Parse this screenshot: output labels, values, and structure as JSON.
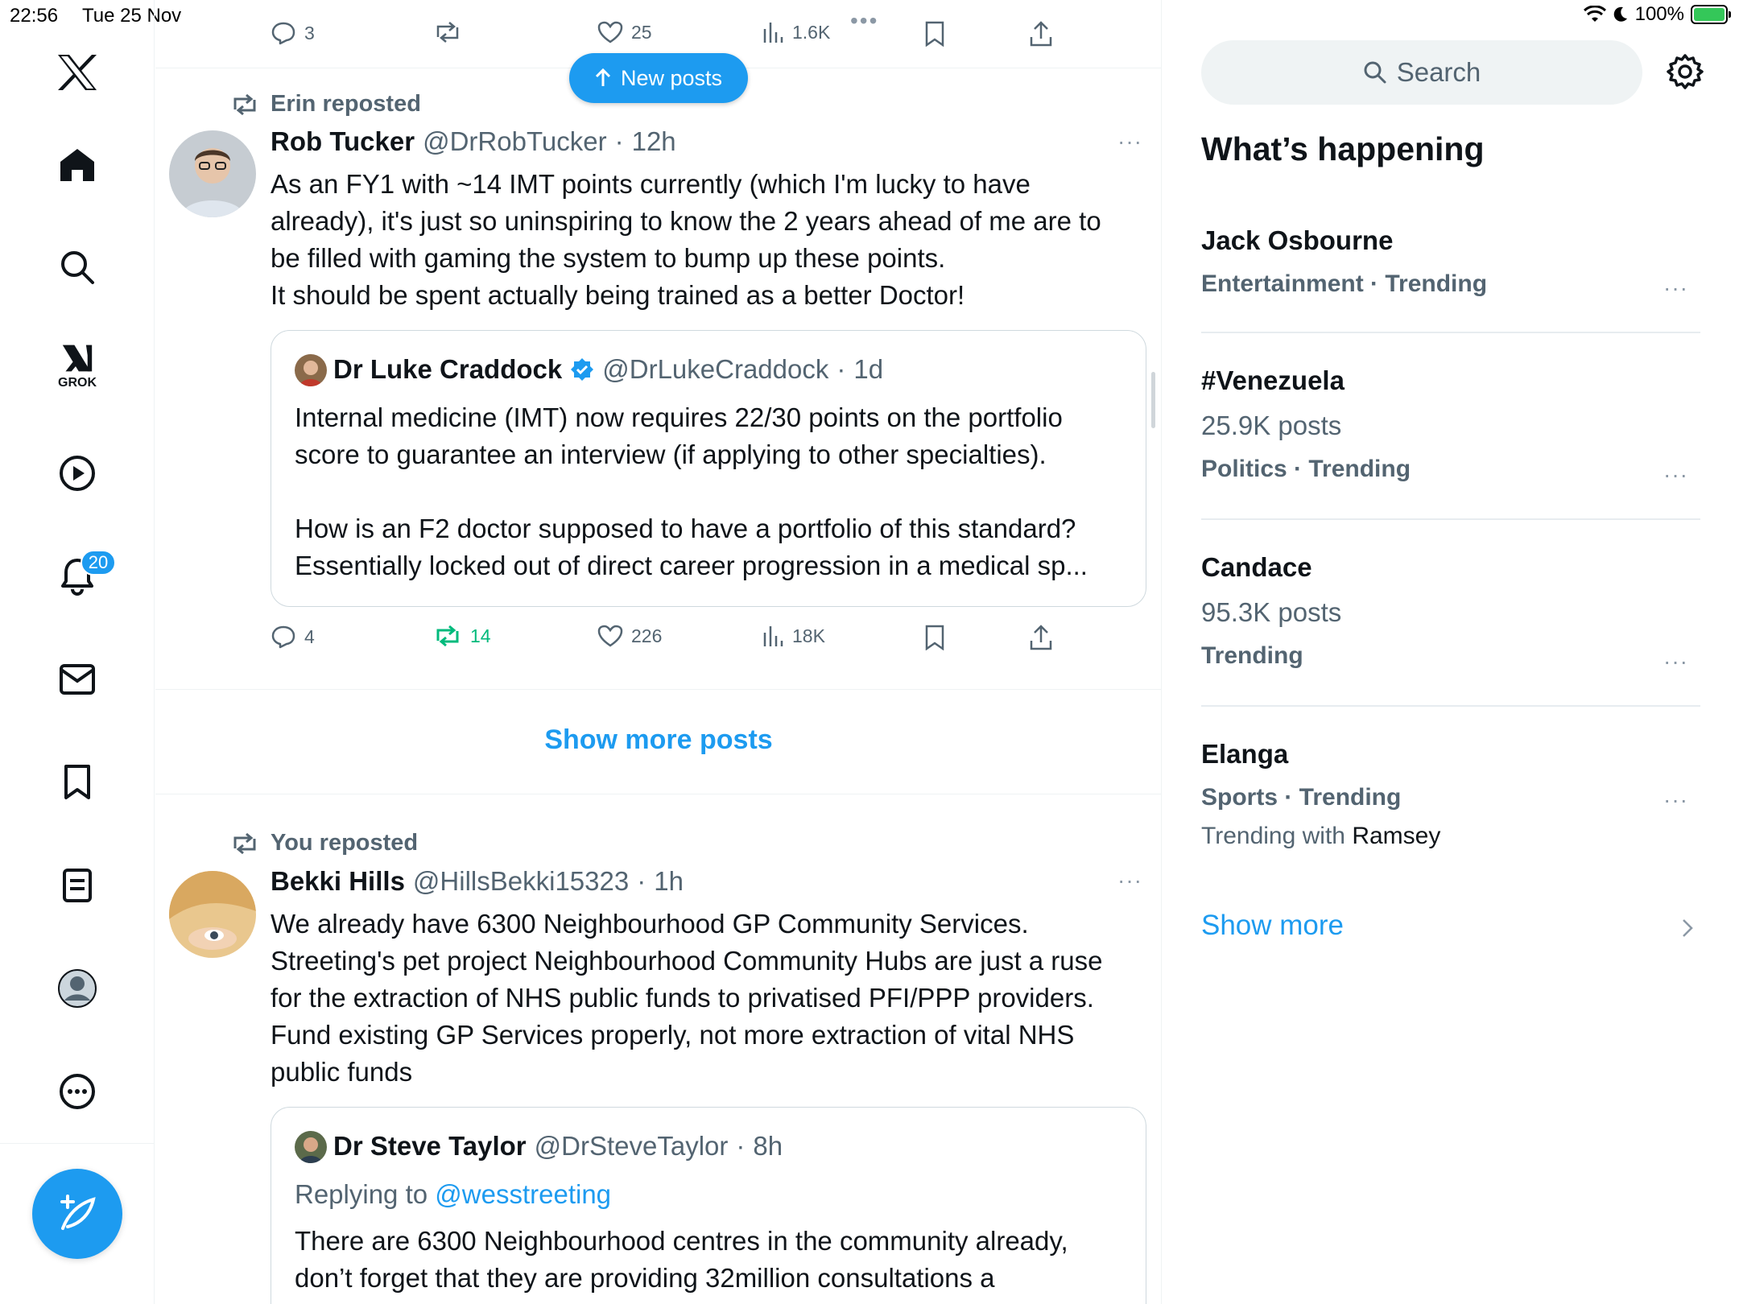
{
  "status_bar": {
    "time": "22:56",
    "date": "Tue 25 Nov",
    "battery": "100%"
  },
  "colors": {
    "accent": "#1d9bf0",
    "repost_green": "#00ba7c",
    "text_secondary": "#536471"
  },
  "sidebar": {
    "logo": "x-logo-icon",
    "grok_label": "GROK",
    "notifications_badge": "20",
    "items": [
      "home-icon",
      "search-icon",
      "grok-icon",
      "video-icon",
      "bell-icon",
      "mail-icon",
      "bookmark-icon",
      "lists-icon",
      "profile-icon",
      "more-icon"
    ]
  },
  "top_actions": {
    "replies": "3",
    "reposts": "",
    "likes": "25",
    "views": "1.6K"
  },
  "new_posts_label": "New posts",
  "tweet1": {
    "repost_by": "Erin reposted",
    "name": "Rob Tucker",
    "handle": "@DrRobTucker",
    "dot": "·",
    "time": "12h",
    "lines": [
      "As an FY1 with ~14 IMT points currently (which I'm lucky to have",
      "already), it's just so uninspiring to know the 2 years ahead of me are to",
      "be filled with gaming the system to bump up these points.",
      "It should be spent actually being trained as a better Doctor!"
    ],
    "quote": {
      "name": "Dr Luke Craddock",
      "handle": "@DrLukeCraddock",
      "dot": "·",
      "time": "1d",
      "lines": [
        "Internal medicine (IMT) now requires 22/30 points on the portfolio",
        "score to guarantee an interview (if applying to other specialties).",
        "",
        "How is an F2 doctor supposed to have a portfolio of this standard?",
        "Essentially locked out of direct career progression in a medical sp..."
      ]
    },
    "actions": {
      "replies": "4",
      "reposts": "14",
      "likes": "226",
      "views": "18K"
    }
  },
  "show_more_posts": "Show more posts",
  "tweet2": {
    "repost_by": "You reposted",
    "name": "Bekki Hills",
    "handle": "@HillsBekki15323",
    "dot": "·",
    "time": "1h",
    "lines": [
      "We already have 6300 Neighbourhood GP Community Services.",
      "Streeting's pet project Neighbourhood Community Hubs are just a ruse",
      "for the extraction of NHS public funds to privatised PFI/PPP providers.",
      "Fund existing GP Services properly, not more extraction of vital NHS",
      "public funds"
    ],
    "quote": {
      "name": "Dr Steve Taylor",
      "handle": "@DrSteveTaylor",
      "dot": "·",
      "time": "8h",
      "replying_to": "Replying to",
      "replying_handle": "@wesstreeting",
      "lines": [
        "There are 6300 Neighbourhood centres in the community already,",
        "don’t forget that they are providing 32million consultations a"
      ]
    }
  },
  "right": {
    "search_placeholder": "Search",
    "section_title": "What’s happening",
    "trends": [
      {
        "title": "Jack Osbourne",
        "count": "",
        "meta": "Entertainment · Trending",
        "with_prefix": "",
        "with_name": ""
      },
      {
        "title": "#Venezuela",
        "count": "25.9K posts",
        "meta": "Politics · Trending",
        "with_prefix": "",
        "with_name": ""
      },
      {
        "title": "Candace",
        "count": "95.3K posts",
        "meta": "Trending",
        "with_prefix": "",
        "with_name": ""
      },
      {
        "title": "Elanga",
        "count": "",
        "meta": "Sports · Trending",
        "with_prefix": "Trending with ",
        "with_name": "Ramsey"
      }
    ],
    "more_dots": "···",
    "show_more": "Show more"
  }
}
